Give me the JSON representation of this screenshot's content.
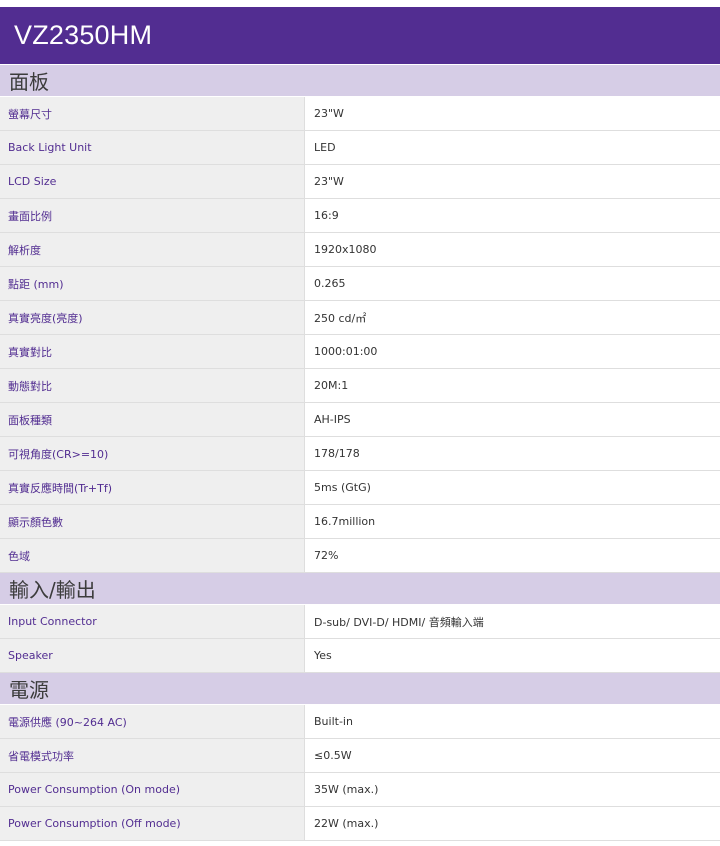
{
  "title": "VZ2350HM",
  "colors": {
    "brand": "#522d91",
    "section_bg": "#d6cde6",
    "label_bg": "#efefef"
  },
  "sections": [
    {
      "name": "面板",
      "rows": [
        {
          "label": "螢幕尺寸",
          "value": "23\"W"
        },
        {
          "label": "Back Light Unit",
          "value": "LED"
        },
        {
          "label": "LCD Size",
          "value": "23\"W"
        },
        {
          "label": "畫面比例",
          "value": "16:9"
        },
        {
          "label": "解析度",
          "value": "1920x1080"
        },
        {
          "label": "點距 (mm)",
          "value": "0.265"
        },
        {
          "label": "真實亮度(亮度)",
          "value": "250 cd/㎡"
        },
        {
          "label": "真實對比",
          "value": "1000:01:00"
        },
        {
          "label": "動態對比",
          "value": "20M:1"
        },
        {
          "label": "面板種類",
          "value": "AH-IPS"
        },
        {
          "label": "可視角度(CR>=10)",
          "value": "178/178"
        },
        {
          "label": "真實反應時間(Tr+Tf)",
          "value": "5ms (GtG)"
        },
        {
          "label": "顯示顏色數",
          "value": "16.7million"
        },
        {
          "label": "色域",
          "value": "72%"
        }
      ]
    },
    {
      "name": "輸入/輸出",
      "rows": [
        {
          "label": "Input Connector",
          "value": "D-sub/ DVI-D/ HDMI/ 音頻輸入端"
        },
        {
          "label": "Speaker",
          "value": "Yes"
        }
      ]
    },
    {
      "name": "電源",
      "rows": [
        {
          "label": "電源供應 (90~264 AC)",
          "value": "Built-in"
        },
        {
          "label": "省電模式功率",
          "value": "≤0.5W"
        },
        {
          "label": "Power Consumption (On mode)",
          "value": "35W (max.)"
        },
        {
          "label": "Power Consumption (Off mode)",
          "value": "22W (max.)"
        }
      ]
    }
  ]
}
